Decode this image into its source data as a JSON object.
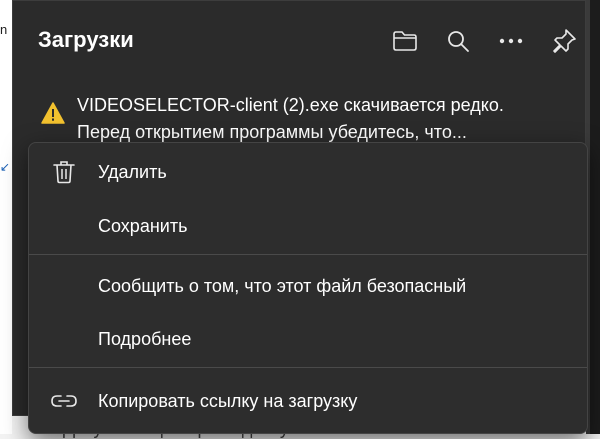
{
  "background": {
    "left_fragment": "n",
    "left_arrow": "↙",
    "doc_name": "Документация право доступа.doc"
  },
  "flyout": {
    "title": "Загрузки",
    "header_icons": [
      "folder-icon",
      "search-icon",
      "more-icon",
      "pin-icon"
    ],
    "warning": {
      "line1": "VIDEOSELECTOR-client (2).exe скачивается редко.",
      "line2": "Перед открытием программы убедитесь, что..."
    }
  },
  "context_menu": {
    "items": [
      {
        "label": "Удалить",
        "icon": "trash-icon"
      },
      {
        "label": "Сохранить",
        "icon": ""
      },
      {
        "label": "Сообщить о том, что этот файл безопасный",
        "icon": ""
      },
      {
        "label": "Подробнее",
        "icon": ""
      },
      {
        "label": "Копировать ссылку на загрузку",
        "icon": "link-icon"
      }
    ]
  },
  "colors": {
    "flyout_bg": "#2b2b2b",
    "menu_bg": "#2d2d2d",
    "warning": "#f2c12e",
    "text": "#ffffff"
  }
}
